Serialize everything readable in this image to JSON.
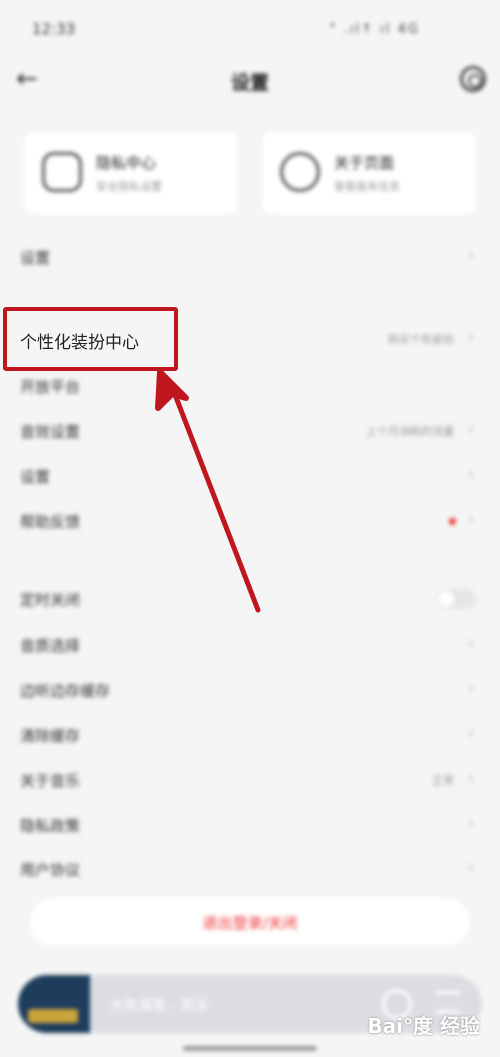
{
  "status_bar": {
    "time": "12:33",
    "icons": "° .ıl↑ ıl 4G"
  },
  "header": {
    "title": "设置",
    "back_icon": "arrow-left-icon",
    "right_icon": "gear-icon"
  },
  "cards": [
    {
      "title": "隐私中心",
      "subtitle": "安全隐私设置",
      "icon": "shield-icon"
    },
    {
      "title": "关于页面",
      "subtitle": "查看版本信息",
      "icon": "info-icon"
    }
  ],
  "rows": [
    {
      "label": "设置",
      "value": "",
      "control": "chevron"
    },
    {
      "label": "个性化装扮中心",
      "value": "购买个性装扮",
      "control": "chevron"
    },
    {
      "label": "开放平台",
      "value": "",
      "control": ""
    },
    {
      "label": "音效设置",
      "value": "上个月消耗的流量",
      "control": "chevron"
    },
    {
      "label": "设置",
      "value": "",
      "control": "chevron"
    },
    {
      "label": "帮助反馈",
      "value": "",
      "control": "dot"
    },
    {
      "label": "定时关闭",
      "value": "",
      "control": "toggle"
    },
    {
      "label": "音质选择",
      "value": "",
      "control": "chevron"
    },
    {
      "label": "边听边存缓存",
      "value": "",
      "control": "chevron"
    },
    {
      "label": "清除缓存",
      "value": "",
      "control": "chevron"
    },
    {
      "label": "关于音乐",
      "value": "正常",
      "control": "chevron"
    },
    {
      "label": "隐私政策",
      "value": "",
      "control": "chevron"
    },
    {
      "label": "用户协议",
      "value": "",
      "control": "chevron"
    }
  ],
  "logout_label": "退出登录/关闭",
  "player": {
    "text": "大鱼海棠 - 周深"
  },
  "annotation": {
    "highlight_text": "个性化装扮中心",
    "color": "#c0161d"
  },
  "watermark": {
    "text": "Bai°度 经验"
  },
  "colors": {
    "accent_red": "#e33333",
    "background": "#f5f5f5",
    "annotation_red": "#c0161d"
  }
}
